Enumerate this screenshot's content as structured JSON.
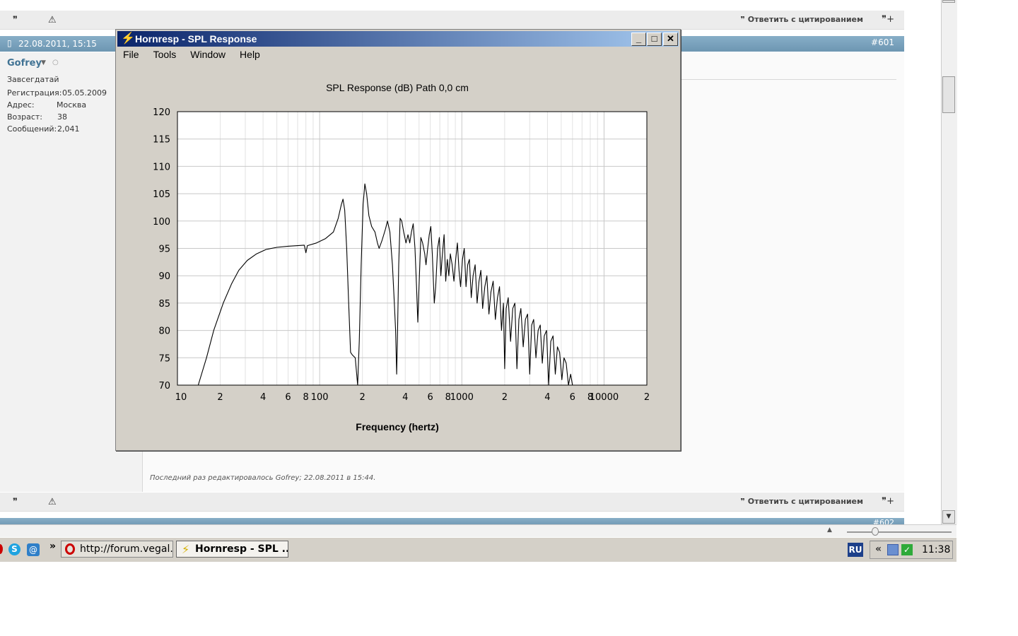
{
  "forum": {
    "quote_label": "Ответить с цитированием",
    "post_date": "22.08.2011, 15:15",
    "post_number": "#601",
    "next_post_number": "#602",
    "user": {
      "name": "Gofrey",
      "title": "Завсегдатай",
      "rows": [
        {
          "label": "Регистрация:",
          "value": "05.05.2009"
        },
        {
          "label": "Адрес:",
          "value": "Москва"
        },
        {
          "label": "Возраст:",
          "value": "38"
        },
        {
          "label": "Сообщений:",
          "value": "2,041"
        }
      ]
    },
    "edit_note": "Последний раз редактировалось Gofrey; 22.08.2011 в 15:44."
  },
  "window": {
    "title": "Hornresp - SPL Response",
    "menu": [
      "File",
      "Tools",
      "Window",
      "Help"
    ],
    "minimize": "_",
    "maximize": "□",
    "close": "✕"
  },
  "taskbar": {
    "more": "»",
    "tasks": [
      {
        "label": "http://forum.vegal...",
        "active": false
      },
      {
        "label": "Hornresp - SPL ...",
        "active": true
      }
    ],
    "lang": "RU",
    "tray_arrow": "«",
    "clock": "11:38"
  },
  "colors": {
    "title_start": "#0a246a",
    "title_end": "#a6caf0",
    "post_header": "#7aa3bf",
    "username": "#417394",
    "window_face": "#d4d0c8"
  },
  "chart_data": {
    "type": "line",
    "title": "SPL Response (dB)   Path 0,0 cm",
    "xlabel": "Frequency (hertz)",
    "ylabel": "",
    "x_scale": "log",
    "xlim": [
      10,
      20000
    ],
    "ylim": [
      70,
      120
    ],
    "x_tick_labels": [
      {
        "v": 10,
        "t": "10"
      },
      {
        "v": 20,
        "t": "2"
      },
      {
        "v": 40,
        "t": "4"
      },
      {
        "v": 60,
        "t": "6"
      },
      {
        "v": 80,
        "t": "8"
      },
      {
        "v": 100,
        "t": "100"
      },
      {
        "v": 200,
        "t": "2"
      },
      {
        "v": 400,
        "t": "4"
      },
      {
        "v": 600,
        "t": "6"
      },
      {
        "v": 800,
        "t": "8"
      },
      {
        "v": 1000,
        "t": "1000"
      },
      {
        "v": 2000,
        "t": "2"
      },
      {
        "v": 4000,
        "t": "4"
      },
      {
        "v": 6000,
        "t": "6"
      },
      {
        "v": 8000,
        "t": "8"
      },
      {
        "v": 10000,
        "t": "10000"
      },
      {
        "v": 20000,
        "t": "2"
      }
    ],
    "y_ticks": [
      70,
      75,
      80,
      85,
      90,
      95,
      100,
      105,
      110,
      115,
      120
    ],
    "grid": true,
    "series": [
      {
        "points": [
          [
            14,
            70
          ],
          [
            16,
            75
          ],
          [
            18,
            80
          ],
          [
            21,
            85
          ],
          [
            24,
            88.5
          ],
          [
            27,
            91
          ],
          [
            31,
            92.8
          ],
          [
            36,
            94
          ],
          [
            42,
            94.8
          ],
          [
            50,
            95.2
          ],
          [
            60,
            95.4
          ],
          [
            70,
            95.5
          ],
          [
            78,
            95.6
          ],
          [
            80,
            94.2
          ],
          [
            82,
            95.5
          ],
          [
            95,
            96
          ],
          [
            110,
            96.8
          ],
          [
            125,
            98
          ],
          [
            135,
            100.5
          ],
          [
            142,
            103
          ],
          [
            146,
            104
          ],
          [
            150,
            102
          ],
          [
            155,
            95
          ],
          [
            160,
            85
          ],
          [
            165,
            76
          ],
          [
            170,
            75.5
          ],
          [
            178,
            75
          ],
          [
            185,
            70
          ],
          [
            190,
            78
          ],
          [
            196,
            92
          ],
          [
            202,
            103
          ],
          [
            208,
            106.8
          ],
          [
            214,
            105
          ],
          [
            222,
            101
          ],
          [
            232,
            99
          ],
          [
            245,
            98
          ],
          [
            255,
            96
          ],
          [
            262,
            95
          ],
          [
            275,
            96.5
          ],
          [
            290,
            98.5
          ],
          [
            300,
            100
          ],
          [
            312,
            98
          ],
          [
            325,
            92
          ],
          [
            335,
            85
          ],
          [
            342,
            80
          ],
          [
            348,
            72
          ],
          [
            352,
            78
          ],
          [
            360,
            92
          ],
          [
            368,
            100.5
          ],
          [
            378,
            100
          ],
          [
            390,
            98
          ],
          [
            405,
            96
          ],
          [
            418,
            97.5
          ],
          [
            430,
            96
          ],
          [
            442,
            98
          ],
          [
            455,
            99.5
          ],
          [
            468,
            95
          ],
          [
            480,
            88
          ],
          [
            490,
            81.5
          ],
          [
            500,
            88
          ],
          [
            515,
            97
          ],
          [
            530,
            96
          ],
          [
            548,
            94
          ],
          [
            560,
            92
          ],
          [
            575,
            95
          ],
          [
            590,
            97.5
          ],
          [
            605,
            99
          ],
          [
            620,
            94
          ],
          [
            640,
            85
          ],
          [
            655,
            88
          ],
          [
            675,
            95
          ],
          [
            695,
            97
          ],
          [
            712,
            90
          ],
          [
            730,
            94
          ],
          [
            750,
            97.5
          ],
          [
            770,
            89
          ],
          [
            790,
            93
          ],
          [
            810,
            90
          ],
          [
            830,
            94
          ],
          [
            855,
            92
          ],
          [
            880,
            89
          ],
          [
            905,
            93
          ],
          [
            930,
            96
          ],
          [
            955,
            91
          ],
          [
            980,
            88
          ],
          [
            1010,
            93
          ],
          [
            1040,
            95
          ],
          [
            1070,
            88
          ],
          [
            1100,
            92
          ],
          [
            1130,
            93
          ],
          [
            1165,
            86
          ],
          [
            1200,
            90
          ],
          [
            1240,
            92
          ],
          [
            1280,
            85
          ],
          [
            1320,
            89
          ],
          [
            1360,
            91
          ],
          [
            1400,
            84
          ],
          [
            1450,
            88
          ],
          [
            1500,
            90
          ],
          [
            1550,
            83
          ],
          [
            1600,
            87
          ],
          [
            1660,
            89
          ],
          [
            1720,
            82
          ],
          [
            1780,
            86
          ],
          [
            1840,
            88
          ],
          [
            1900,
            80
          ],
          [
            1960,
            85
          ],
          [
            2000,
            73
          ],
          [
            2050,
            84
          ],
          [
            2120,
            86
          ],
          [
            2200,
            78
          ],
          [
            2280,
            84
          ],
          [
            2360,
            85
          ],
          [
            2440,
            73
          ],
          [
            2520,
            82
          ],
          [
            2600,
            84
          ],
          [
            2700,
            77
          ],
          [
            2800,
            82
          ],
          [
            2900,
            83
          ],
          [
            3000,
            72
          ],
          [
            3100,
            81
          ],
          [
            3200,
            82
          ],
          [
            3320,
            75
          ],
          [
            3440,
            80
          ],
          [
            3560,
            81
          ],
          [
            3680,
            74
          ],
          [
            3800,
            79
          ],
          [
            3940,
            80
          ],
          [
            4080,
            70
          ],
          [
            4220,
            78
          ],
          [
            4380,
            79
          ],
          [
            4540,
            72
          ],
          [
            4700,
            77
          ],
          [
            4870,
            76
          ],
          [
            5050,
            71
          ],
          [
            5230,
            75
          ],
          [
            5420,
            74
          ],
          [
            5620,
            70
          ],
          [
            5820,
            72
          ],
          [
            6000,
            70
          ]
        ]
      }
    ]
  }
}
